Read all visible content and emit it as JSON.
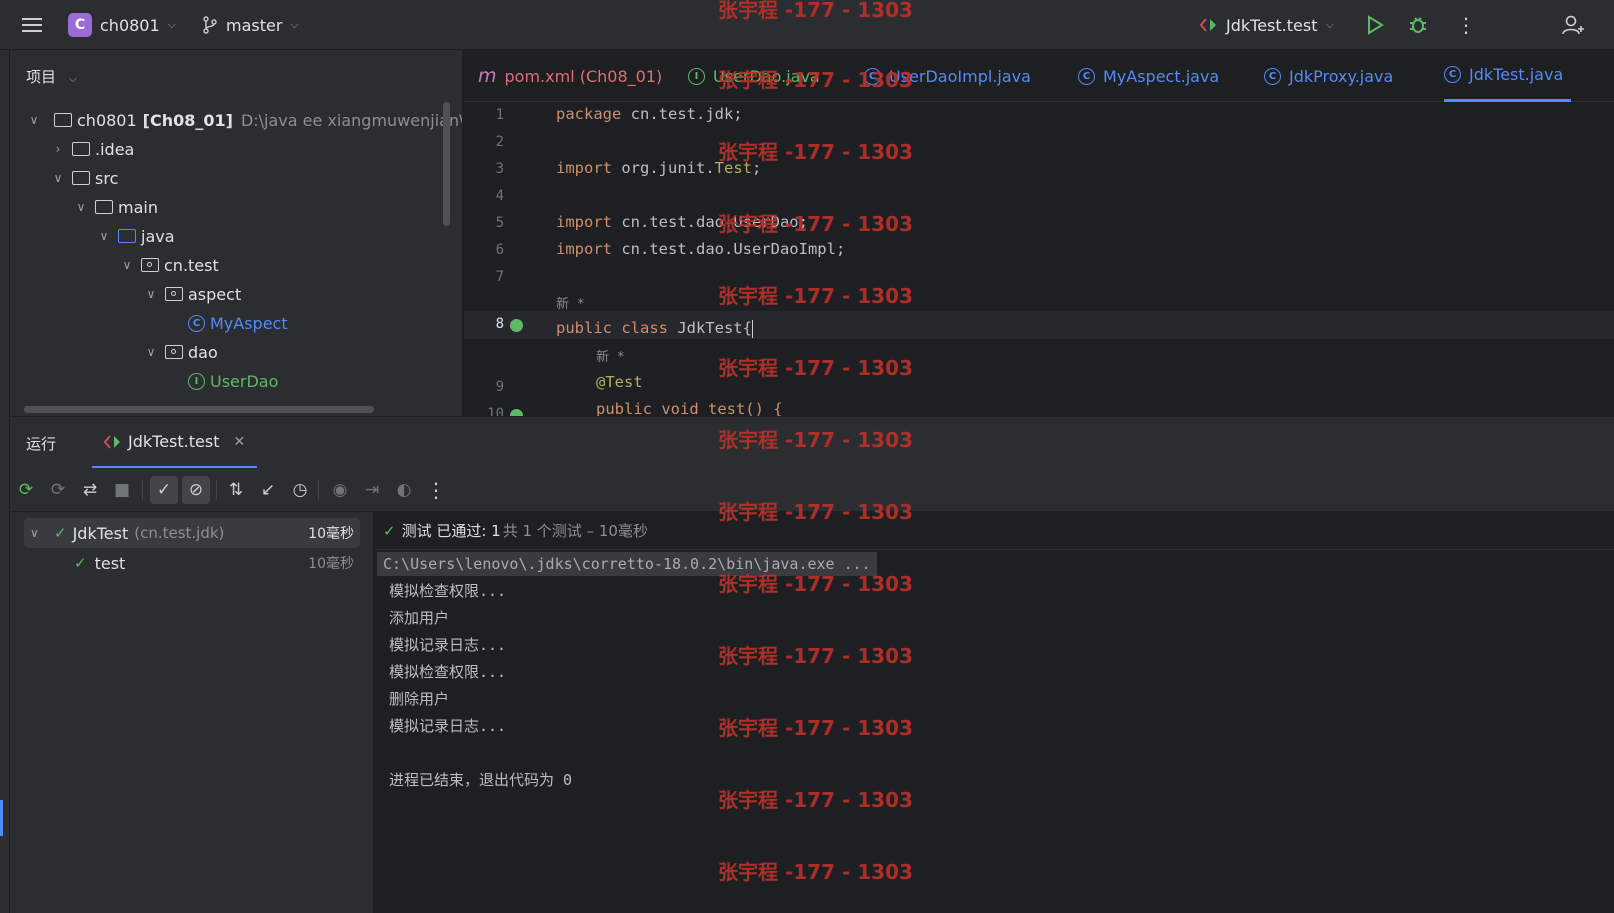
{
  "titlebar": {
    "project_badge": "C",
    "project_name": "ch0801",
    "branch": "master",
    "run_config": "JdkTest.test"
  },
  "project_panel": {
    "title": "项目",
    "tree": [
      {
        "label": "ch0801",
        "suffix": "[Ch08_01]",
        "path": "D:\\java ee xiangmuwenjian\\ch"
      },
      {
        "label": ".idea"
      },
      {
        "label": "src"
      },
      {
        "label": "main"
      },
      {
        "label": "java"
      },
      {
        "label": "cn.test"
      },
      {
        "label": "aspect"
      },
      {
        "label": "MyAspect"
      },
      {
        "label": "dao"
      },
      {
        "label": "UserDao"
      }
    ]
  },
  "editor": {
    "tabs": [
      {
        "label": "pom.xml (Ch08_01)",
        "icon": "maven-icon"
      },
      {
        "label": "UserDao.java",
        "icon": "interface-icon"
      },
      {
        "label": "UserDaoImpl.java",
        "icon": "class-icon"
      },
      {
        "label": "MyAspect.java",
        "icon": "class-icon"
      },
      {
        "label": "JdkProxy.java",
        "icon": "class-icon"
      },
      {
        "label": "JdkTest.java",
        "icon": "class-icon",
        "active": true
      }
    ],
    "line_numbers": [
      "1",
      "2",
      "3",
      "4",
      "5",
      "6",
      "7",
      "8",
      "9",
      "10"
    ],
    "code": {
      "line1_kw": "package",
      "line1_rest": " cn.test.jdk;",
      "line3_kw": "import",
      "line3_rest": " org.junit.",
      "line3_cls": "Test",
      "line3_end": ";",
      "line5_kw": "import",
      "line5_rest": " cn.test.dao.UserDao;",
      "line6_kw": "import",
      "line6_rest": " cn.test.dao.UserDaoImpl;",
      "hint1": "新 *",
      "line8_kw": "public class",
      "line8_rest": " JdkTest{",
      "hint2": "新 *",
      "line9": "@Test",
      "line10_partial": "public void test() {"
    }
  },
  "run_panel": {
    "title": "运行",
    "tab_label": "JdkTest.test",
    "test_tree": [
      {
        "label": "JdkTest",
        "qualifier": "(cn.test.jdk)",
        "time": "10毫秒"
      },
      {
        "label": "test",
        "time": "10毫秒"
      }
    ],
    "status": {
      "passed": "测试 已通过: 1",
      "summary": "共 1 个测试 – 10毫秒"
    },
    "console": [
      "C:\\Users\\lenovo\\.jdks\\corretto-18.0.2\\bin\\java.exe ...",
      "模拟检查权限...",
      "添加用户",
      "模拟记录日志...",
      "模拟检查权限...",
      "删除用户",
      "模拟记录日志...",
      "",
      "进程已结束，退出代码为 0"
    ]
  },
  "watermark": "张宇程 -177 - 1303",
  "colors": {
    "accent": "#548af7",
    "success": "#5fb865",
    "keyword": "#cf8e6d",
    "annotation": "#b3ae60",
    "watermark": "#c0302a",
    "maven": "#c77dbb"
  }
}
